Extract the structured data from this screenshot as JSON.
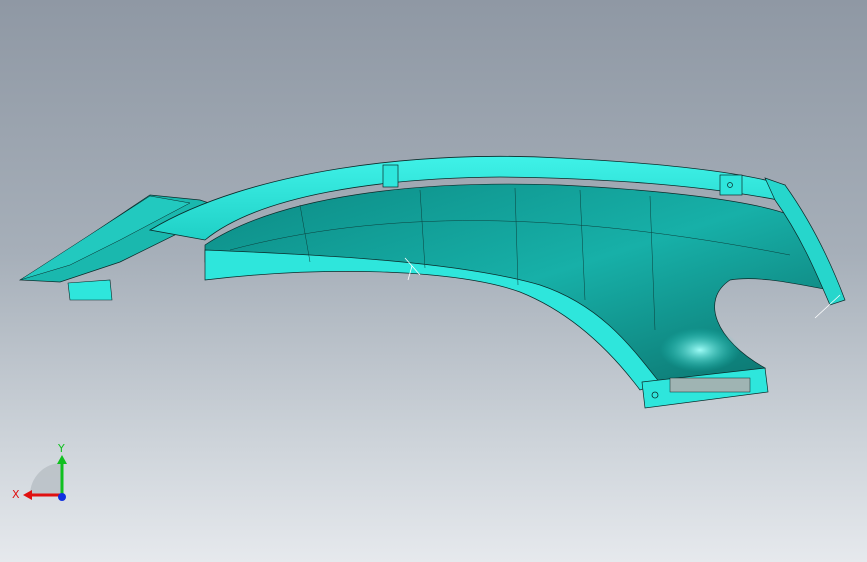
{
  "viewport": {
    "background_top": "#8f98a4",
    "background_bottom": "#e6e9ed"
  },
  "model": {
    "surface_color": "#2ee6dc",
    "shade_color": "#0a8f88",
    "edge_color": "#0b2b2a"
  },
  "triad": {
    "x_label": "X",
    "y_label": "Y",
    "x_color": "#e01010",
    "y_color": "#10c020",
    "z_color": "#1030e0"
  }
}
